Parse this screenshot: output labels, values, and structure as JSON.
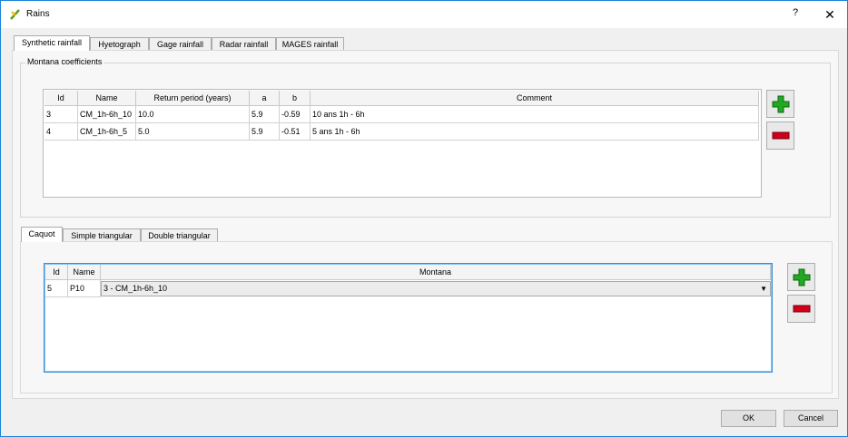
{
  "window": {
    "title": "Rains",
    "help": "?",
    "close": "✕"
  },
  "top_tabs": [
    "Synthetic rainfall",
    "Hyetograph",
    "Gage rainfall",
    "Radar rainfall",
    "MAGES rainfall"
  ],
  "montana": {
    "group_title": "Montana coefficients",
    "headers": [
      "Id",
      "Name",
      "Return period (years)",
      "a",
      "b",
      "Comment"
    ],
    "rows": [
      [
        "3",
        "CM_1h-6h_10",
        "10.0",
        "5.9",
        "-0.59",
        "10 ans 1h - 6h"
      ],
      [
        "4",
        "CM_1h-6h_5",
        "5.0",
        "5.9",
        "-0.51",
        "5 ans 1h - 6h"
      ]
    ]
  },
  "sub_tabs": [
    "Caquot",
    "Simple triangular",
    "Double triangular"
  ],
  "caquot": {
    "headers": [
      "Id",
      "Name",
      "Montana"
    ],
    "rows": [
      [
        "5",
        "P10",
        "3 - CM_1h-6h_10"
      ]
    ]
  },
  "icons": {
    "add": "plus-icon",
    "remove": "minus-icon",
    "app": "qgis-icon"
  },
  "colors": {
    "add": "#22a822",
    "remove": "#d0001a",
    "focus": "#3c8ed6"
  },
  "buttons": {
    "ok": "OK",
    "cancel": "Cancel"
  }
}
